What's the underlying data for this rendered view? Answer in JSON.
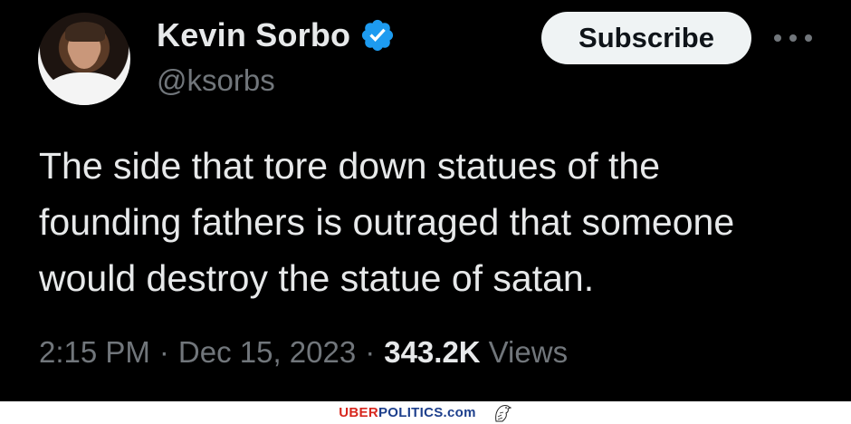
{
  "author": {
    "name": "Kevin Sorbo",
    "handle": "@ksorbs",
    "verified": true
  },
  "actions": {
    "subscribe_label": "Subscribe"
  },
  "tweet": {
    "text": "The side that tore down statues of the\nfounding fathers is outraged that someone\nwould destroy the statue of satan.",
    "time": "2:15 PM",
    "separator": "·",
    "date": "Dec 15, 2023",
    "views_count": "343.2K",
    "views_label": "Views"
  },
  "watermark": {
    "brand_uber": "UBER",
    "brand_politics": "POLITICS",
    "brand_com": ".com"
  },
  "colors": {
    "background": "#000000",
    "text_primary": "#e7e9ea",
    "text_secondary": "#71767b",
    "verified_blue": "#1d9bf0",
    "button_bg": "#eff3f4",
    "brand_red": "#d7261d",
    "brand_blue": "#1d3f8c"
  }
}
